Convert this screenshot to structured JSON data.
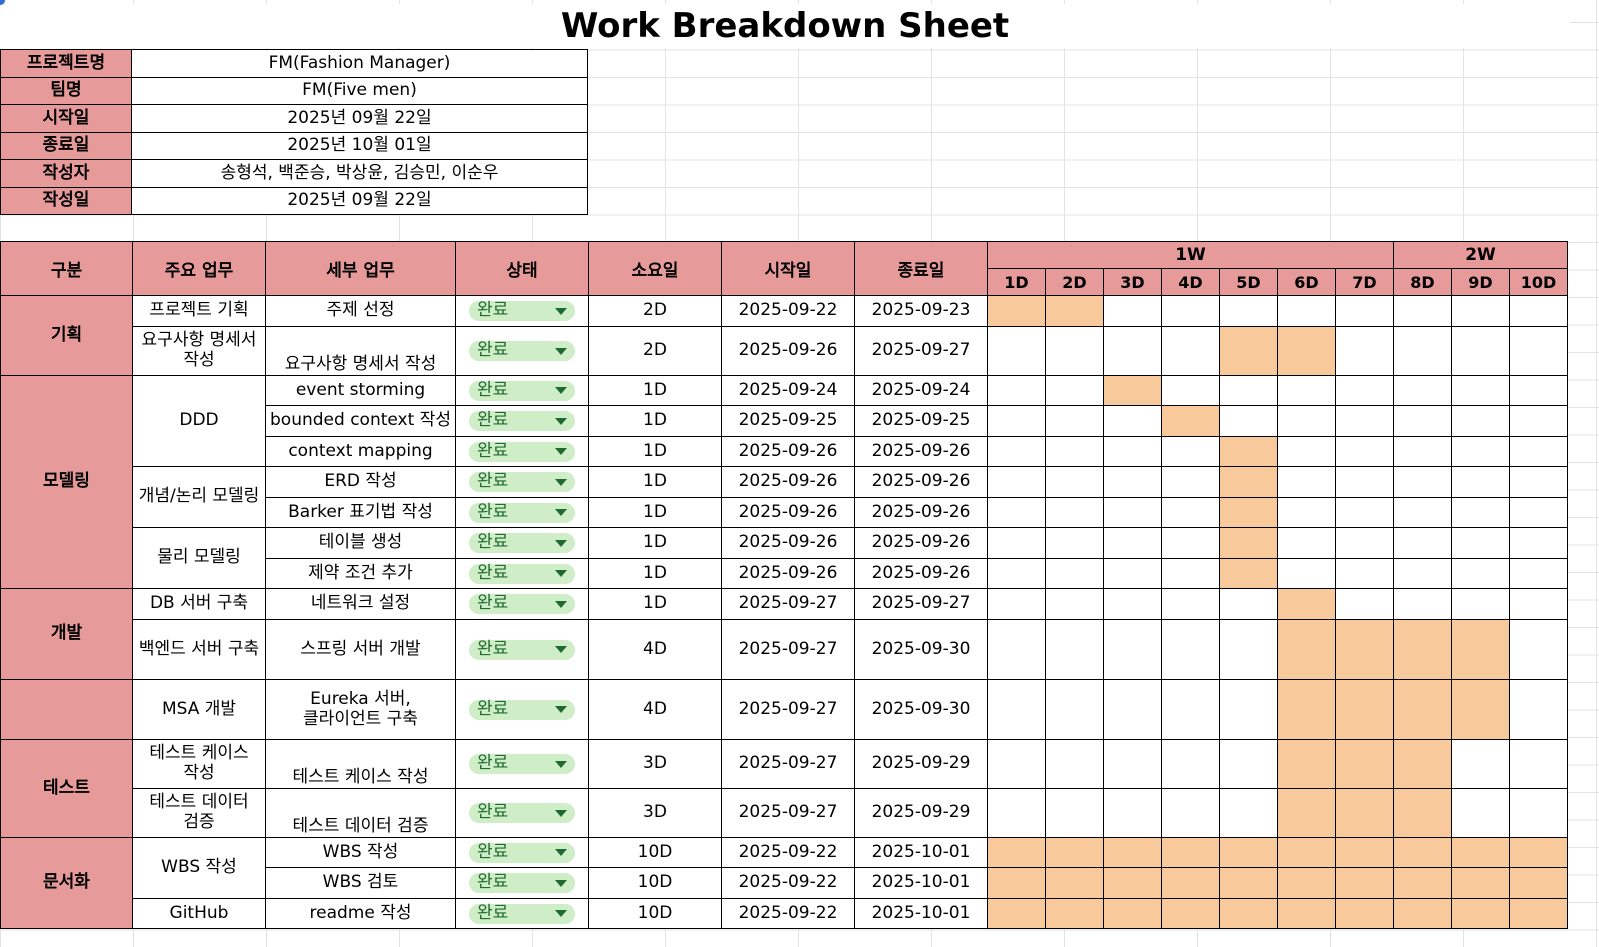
{
  "title": "Work Breakdown Sheet",
  "info": [
    {
      "label": "프로젝트명",
      "value": "FM(Fashion Manager)"
    },
    {
      "label": "팀명",
      "value": "FM(Five men)"
    },
    {
      "label": "시작일",
      "value": "2025년 09월 22일"
    },
    {
      "label": "종료일",
      "value": "2025년 10월 01일"
    },
    {
      "label": "작성자",
      "value": "송형석, 백준승, 박상윤, 김승민, 이순우"
    },
    {
      "label": "작성일",
      "value": "2025년 09월 22일"
    }
  ],
  "headers": {
    "category": "구분",
    "main": "주요 업무",
    "detail": "세부 업무",
    "status": "상태",
    "duration": "소요일",
    "start": "시작일",
    "end": "종료일",
    "weeks": [
      "1W",
      "2W"
    ],
    "days": [
      "1D",
      "2D",
      "3D",
      "4D",
      "5D",
      "6D",
      "7D",
      "8D",
      "9D",
      "10D"
    ]
  },
  "categories": [
    {
      "name": "기획",
      "rows": 2
    },
    {
      "name": "모델링",
      "rows": 7
    },
    {
      "name": "개발",
      "rows": 2
    },
    {
      "name": "",
      "rows": 1
    },
    {
      "name": "테스트",
      "rows": 2
    },
    {
      "name": "문서화",
      "rows": 3
    }
  ],
  "main_tasks": [
    {
      "name": "프로젝트 기획",
      "rows": 1
    },
    {
      "name": "요구사항 명세서\n작성",
      "rows": 1
    },
    {
      "name": "DDD",
      "rows": 3
    },
    {
      "name": "개념/논리 모델링",
      "rows": 2
    },
    {
      "name": "물리 모델링",
      "rows": 2
    },
    {
      "name": "DB 서버 구축",
      "rows": 1
    },
    {
      "name": "백엔드 서버 구축",
      "rows": 1
    },
    {
      "name": "MSA 개발",
      "rows": 1
    },
    {
      "name": "테스트 케이스\n작성",
      "rows": 1
    },
    {
      "name": "테스트 데이터\n검증",
      "rows": 1
    },
    {
      "name": "WBS 작성",
      "rows": 2
    },
    {
      "name": "GitHub",
      "rows": 1
    }
  ],
  "rows": [
    {
      "detail": "주제 선정",
      "status": "완료",
      "duration": "2D",
      "start": "2025-09-22",
      "end": "2025-09-23",
      "days": [
        1,
        2
      ]
    },
    {
      "detail": "요구사항 명세서 작성",
      "status": "완료",
      "duration": "2D",
      "start": "2025-09-26",
      "end": "2025-09-27",
      "days": [
        5,
        6
      ]
    },
    {
      "detail": "event storming",
      "status": "완료",
      "duration": "1D",
      "start": "2025-09-24",
      "end": "2025-09-24",
      "days": [
        3
      ]
    },
    {
      "detail": "bounded context 작성",
      "status": "완료",
      "duration": "1D",
      "start": "2025-09-25",
      "end": "2025-09-25",
      "days": [
        4
      ]
    },
    {
      "detail": "context mapping",
      "status": "완료",
      "duration": "1D",
      "start": "2025-09-26",
      "end": "2025-09-26",
      "days": [
        5
      ]
    },
    {
      "detail": "ERD 작성",
      "status": "완료",
      "duration": "1D",
      "start": "2025-09-26",
      "end": "2025-09-26",
      "days": [
        5
      ]
    },
    {
      "detail": "Barker 표기법 작성",
      "status": "완료",
      "duration": "1D",
      "start": "2025-09-26",
      "end": "2025-09-26",
      "days": [
        5
      ]
    },
    {
      "detail": "테이블 생성",
      "status": "완료",
      "duration": "1D",
      "start": "2025-09-26",
      "end": "2025-09-26",
      "days": [
        5
      ]
    },
    {
      "detail": "제약 조건 추가",
      "status": "완료",
      "duration": "1D",
      "start": "2025-09-26",
      "end": "2025-09-26",
      "days": [
        5
      ]
    },
    {
      "detail": "네트워크 설정",
      "status": "완료",
      "duration": "1D",
      "start": "2025-09-27",
      "end": "2025-09-27",
      "days": [
        6
      ]
    },
    {
      "detail": "스프링 서버 개발",
      "status": "완료",
      "duration": "4D",
      "start": "2025-09-27",
      "end": "2025-09-30",
      "days": [
        6,
        7,
        8,
        9
      ]
    },
    {
      "detail": "Eureka 서버,\n클라이언트 구축",
      "status": "완료",
      "duration": "4D",
      "start": "2025-09-27",
      "end": "2025-09-30",
      "days": [
        6,
        7,
        8,
        9
      ]
    },
    {
      "detail": "테스트 케이스 작성",
      "status": "완료",
      "duration": "3D",
      "start": "2025-09-27",
      "end": "2025-09-29",
      "days": [
        6,
        7,
        8
      ]
    },
    {
      "detail": "테스트 데이터 검증",
      "status": "완료",
      "duration": "3D",
      "start": "2025-09-27",
      "end": "2025-09-29",
      "days": [
        6,
        7,
        8
      ]
    },
    {
      "detail": "WBS 작성",
      "status": "완료",
      "duration": "10D",
      "start": "2025-09-22",
      "end": "2025-10-01",
      "days": [
        1,
        2,
        3,
        4,
        5,
        6,
        7,
        8,
        9,
        10
      ]
    },
    {
      "detail": "WBS 검토",
      "status": "완료",
      "duration": "10D",
      "start": "2025-09-22",
      "end": "2025-10-01",
      "days": [
        1,
        2,
        3,
        4,
        5,
        6,
        7,
        8,
        9,
        10
      ]
    },
    {
      "detail": "readme  작성",
      "status": "완료",
      "duration": "10D",
      "start": "2025-09-22",
      "end": "2025-10-01",
      "days": [
        1,
        2,
        3,
        4,
        5,
        6,
        7,
        8,
        9,
        10
      ]
    }
  ],
  "colors": {
    "header_fill": "#e79a9a",
    "gantt_fill": "#f8c99b",
    "status_pill": "#cfedc7",
    "status_text": "#1f6b2f"
  }
}
